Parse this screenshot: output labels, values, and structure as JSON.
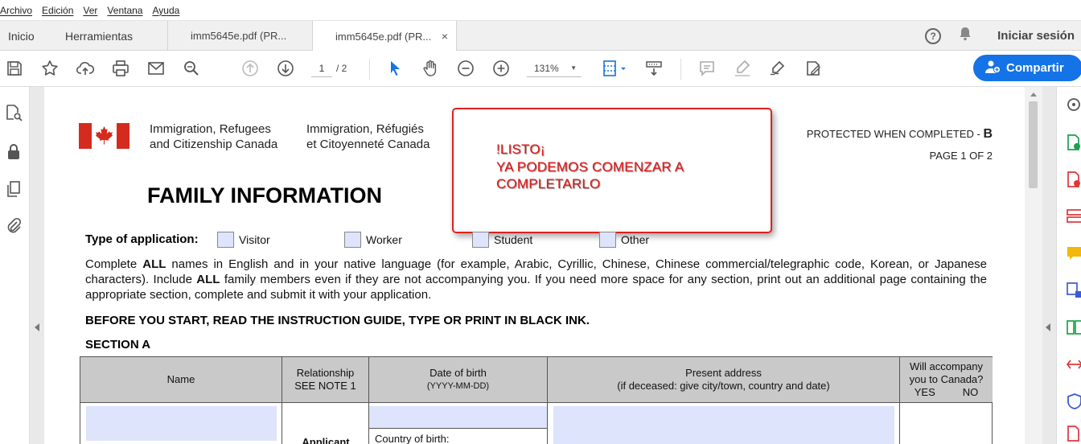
{
  "menu": [
    "Archivo",
    "Edición",
    "Ver",
    "Ventana",
    "Ayuda"
  ],
  "tabs": {
    "home": "Inicio",
    "tools": "Herramientas",
    "doc1": "imm5645e.pdf (PR...",
    "doc2": "imm5645e.pdf (PR...",
    "close": "×"
  },
  "header": {
    "help": "?",
    "signin": "Iniciar sesión"
  },
  "toolbar": {
    "page_current": "1",
    "page_total": "/ 2",
    "zoom": "131%",
    "share_label": "Compartir",
    "colors": {
      "accent": "#1473e6"
    }
  },
  "document": {
    "gov_en_line1": "Immigration, Refugees",
    "gov_en_line2": "and Citizenship Canada",
    "gov_fr_line1": "Immigration, Réfugiés",
    "gov_fr_line2": "et Citoyenneté Canada",
    "protected_prefix": "PROTECTED WHEN COMPLETED - ",
    "protected_level": "B",
    "page_of": "PAGE 1 OF 2",
    "title": "FAMILY INFORMATION",
    "note_line1": "!LISTO¡",
    "note_line2": "YA PODEMOS COMENZAR A",
    "note_line3": "COMPLETARLO",
    "type_label": "Type of application:",
    "type_options": [
      "Visitor",
      "Worker",
      "Student",
      "Other"
    ],
    "instructions_p1": "Complete ",
    "instructions_b1": "ALL",
    "instructions_p2": " names in English and in your native language (for example, Arabic, Cyrillic, Chinese, Chinese commercial/telegraphic code, Korean, or Japanese characters). Include ",
    "instructions_b2": "ALL",
    "instructions_p3": " family members even if they are not accompanying you. If you need more space for any section, print out an additional page containing the appropriate section, complete and submit it with your application.",
    "before_start": "BEFORE YOU START, READ THE INSTRUCTION GUIDE, TYPE OR PRINT IN BLACK INK.",
    "section": "SECTION A",
    "table": {
      "h_name": "Name",
      "h_rel_1": "Relationship",
      "h_rel_2": "SEE NOTE 1",
      "h_dob_1": "Date of birth",
      "h_dob_2": "(YYYY-MM-DD)",
      "h_addr_1": "Present address",
      "h_addr_2": "(if deceased: give city/town, country and date)",
      "h_acc_1": "Will accompany",
      "h_acc_2": "you to Canada?",
      "h_acc_yes": "YES",
      "h_acc_no": "NO",
      "applicant": "Applicant",
      "country_of_birth": "Country of birth:"
    }
  }
}
